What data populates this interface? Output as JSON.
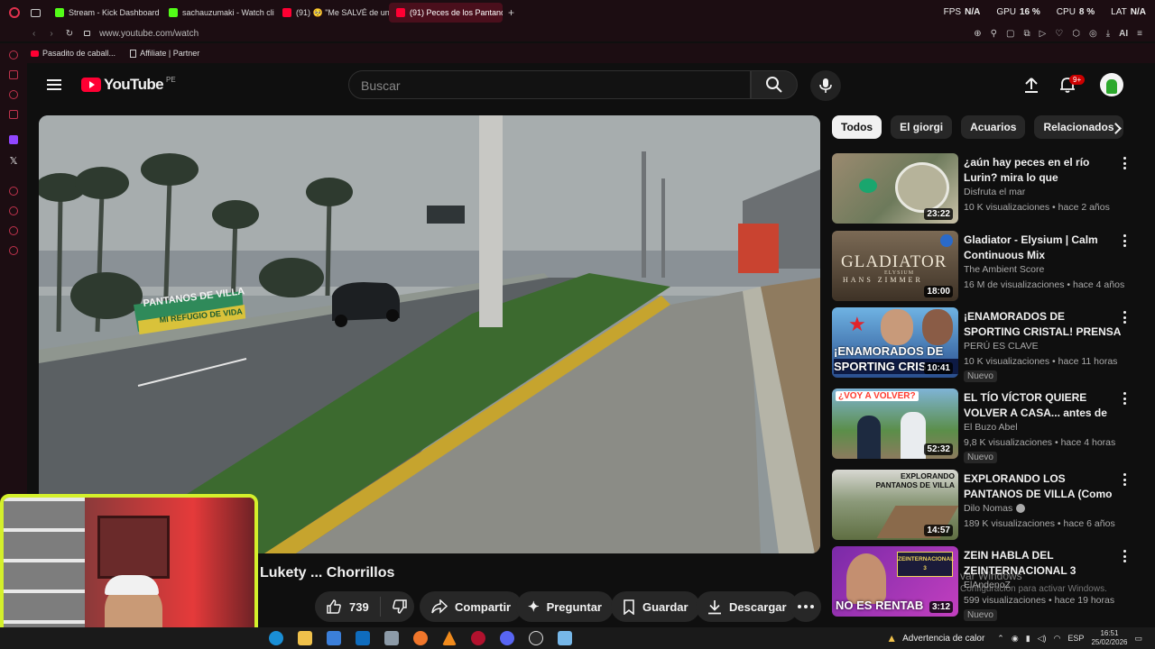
{
  "browser": {
    "tabs": [
      {
        "label": "Stream - Kick Dashboard",
        "color": "#53fc18"
      },
      {
        "label": "sachauzumaki - Watch cli",
        "color": "#53fc18"
      },
      {
        "label": "(91) 🥺 \"Me SALVÉ de un",
        "color": "#ff0033"
      },
      {
        "label": "(91) Peces de los Pantano",
        "color": "#ff0033",
        "active": true
      }
    ],
    "url": "www.youtube.com/watch",
    "bookmarks": [
      "Pasadito de caball...",
      "Affiliate | Partner"
    ],
    "stats": {
      "fps_label": "FPS",
      "fps": "N/A",
      "gpu_label": "GPU",
      "gpu": "16 %",
      "cpu_label": "CPU",
      "cpu": "8 %",
      "lat_label": "LAT",
      "lat": "N/A"
    },
    "ai_label": "AI"
  },
  "youtube": {
    "logo": "YouTube",
    "region": "PE",
    "search_placeholder": "Buscar",
    "notif_count": "9+",
    "chips": [
      "Todos",
      "El giorgi",
      "Acuarios",
      "Relacionados"
    ],
    "video_title": "Lukety ... Chorrillos",
    "actions": {
      "likes": "739",
      "share": "Compartir",
      "ask": "Preguntar",
      "save": "Guardar",
      "download": "Descargar"
    },
    "recommendations": [
      {
        "title": "¿aún hay peces en el río Lurin? mira lo que encontramos.",
        "channel": "Disfruta el mar",
        "meta": "10 K visualizaciones • hace 2 años",
        "duration": "23:22",
        "badge": ""
      },
      {
        "title": "Gladiator - Elysium | Calm Continuous Mix",
        "channel": "The Ambient Score",
        "meta": "16 M de visualizaciones • hace 4 años",
        "duration": "18:00",
        "badge": ""
      },
      {
        "title": "¡ENAMORADOS DE SPORTING CRISTAL! PRENSA ELOGIA A ...",
        "channel": "PERÚ ES CLAVE",
        "meta": "10 K visualizaciones • hace 11 horas",
        "duration": "10:41",
        "badge": "Nuevo"
      },
      {
        "title": "EL TÍO VÍCTOR QUIERE VOLVER A CASA... antes de su operación",
        "channel": "El Buzo Abel",
        "meta": "9,8 K visualizaciones • hace 4 horas",
        "duration": "52:32",
        "badge": "Nuevo"
      },
      {
        "title": "EXPLORANDO LOS PANTANOS DE VILLA (Como nunca antes l...",
        "channel": "Dilo Nomas",
        "meta": "189 K visualizaciones • hace 6 años",
        "duration": "14:57",
        "badge": ""
      },
      {
        "title": "ZEIN HABLA DEL ZEINTERNACIONAL 3",
        "channel": "ElAndenoZ",
        "meta": "599 visualizaciones • hace 19 horas",
        "duration": "3:12",
        "badge": "Nuevo"
      }
    ],
    "thumb_texts": {
      "gladiator": "GLADIATOR",
      "gladiator_sub": "ELYSIUM",
      "gladiator_credit": "HANS ZIMMER",
      "sporting_line1": "¡ENAMORADOS DE",
      "sporting_line2": "SPORTING CRIS",
      "victor": "¿VOY A VOLVER?",
      "pantanos_line1": "EXPLORANDO",
      "pantanos_line2": "PANTANOS DE VILLA",
      "zein_card": "ZEINTERNACIONAL",
      "zein_card_num": "3",
      "zein": "NO ES RENTAB"
    },
    "video_sign_text": "MI REFUGIO DE VIDA",
    "video_sign_brand": "PANTANOS DE VILLA",
    "activation_line1": "var Windows",
    "activation_line2": "Configuración para activar Windows."
  },
  "taskbar": {
    "weather": "Advertencia de calor",
    "lang": "ESP",
    "time": "16:51",
    "date": "25/02/2026"
  }
}
